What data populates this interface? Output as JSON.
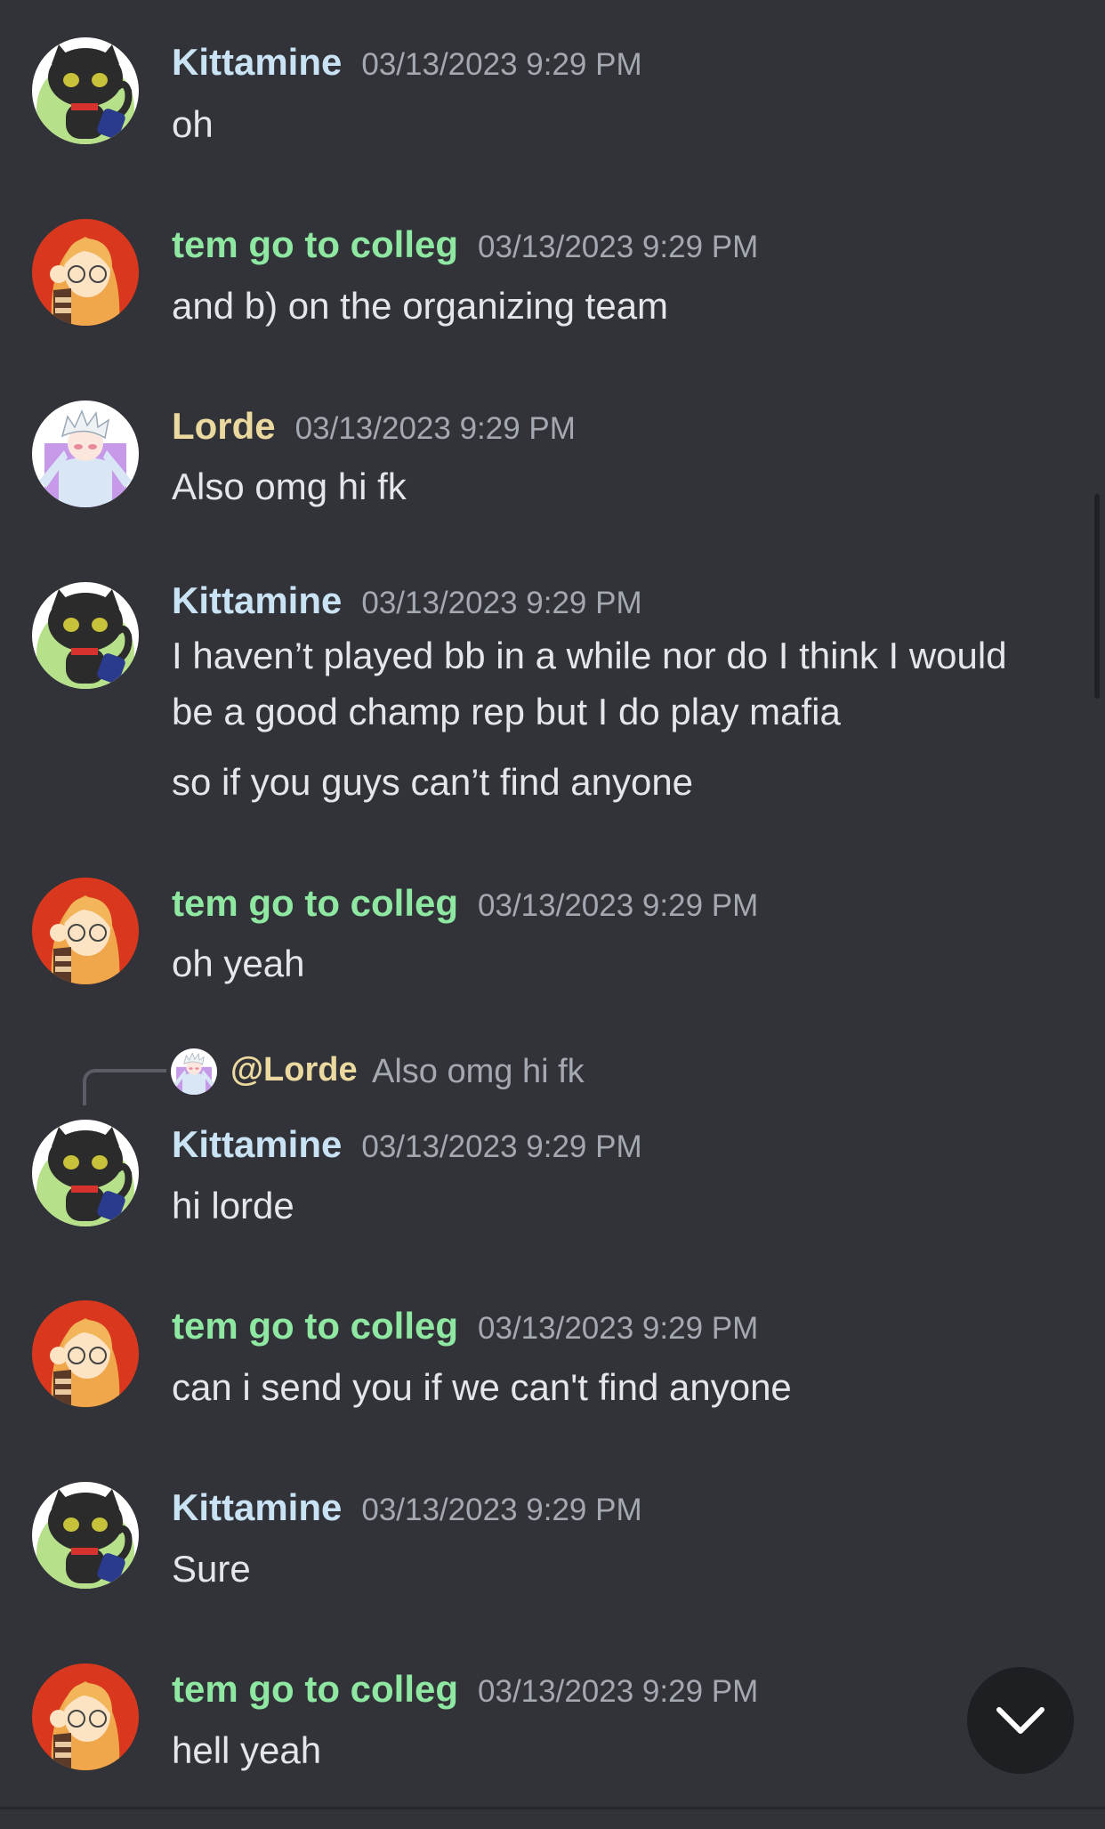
{
  "users": {
    "kittamine": {
      "name": "Kittamine",
      "avatar_icon": "black-cat-avatar",
      "name_color": "#c9e3f5"
    },
    "tem": {
      "name": "tem go to colleg",
      "avatar_icon": "orange-hair-girl-avatar",
      "name_color": "#8fe8a2"
    },
    "lorde": {
      "name": "Lorde",
      "avatar_icon": "white-hair-anime-avatar",
      "name_color": "#ebd9a0"
    }
  },
  "messages": [
    {
      "author": "Kittamine",
      "time": "03/13/2023 9:29 PM",
      "lines": [
        "oh"
      ]
    },
    {
      "author": "tem go to colleg",
      "time": "03/13/2023 9:29 PM",
      "lines": [
        "and b) on the organizing team"
      ]
    },
    {
      "author": "Lorde",
      "time": "03/13/2023 9:29 PM",
      "lines": [
        "Also omg hi fk"
      ]
    },
    {
      "author": "Kittamine",
      "time": "03/13/2023 9:29 PM",
      "lines": [
        "I haven’t played bb in a while nor do I think I would",
        "be a good champ rep but I do play mafia",
        "so if you guys can’t find anyone"
      ]
    },
    {
      "author": "tem go to colleg",
      "time": "03/13/2023 9:29 PM",
      "lines": [
        "oh yeah"
      ]
    },
    {
      "author": "Kittamine",
      "time": "03/13/2023 9:29 PM",
      "lines": [
        "hi lorde"
      ],
      "reply": {
        "mention": "@Lorde",
        "text": "Also omg hi fk"
      }
    },
    {
      "author": "tem go to colleg",
      "time": "03/13/2023 9:29 PM",
      "lines": [
        "can i send you if we can't find anyone"
      ]
    },
    {
      "author": "Kittamine",
      "time": "03/13/2023 9:29 PM",
      "lines": [
        "Sure"
      ]
    },
    {
      "author": "tem go to colleg",
      "time": "03/13/2023 9:29 PM",
      "lines": [
        "hell yeah"
      ]
    }
  ],
  "controls": {
    "jump_to_bottom_icon": "chevron-down-icon"
  },
  "colors": {
    "background": "#313338",
    "text": "#e4e6ea",
    "timestamp": "#a4a8b1"
  }
}
